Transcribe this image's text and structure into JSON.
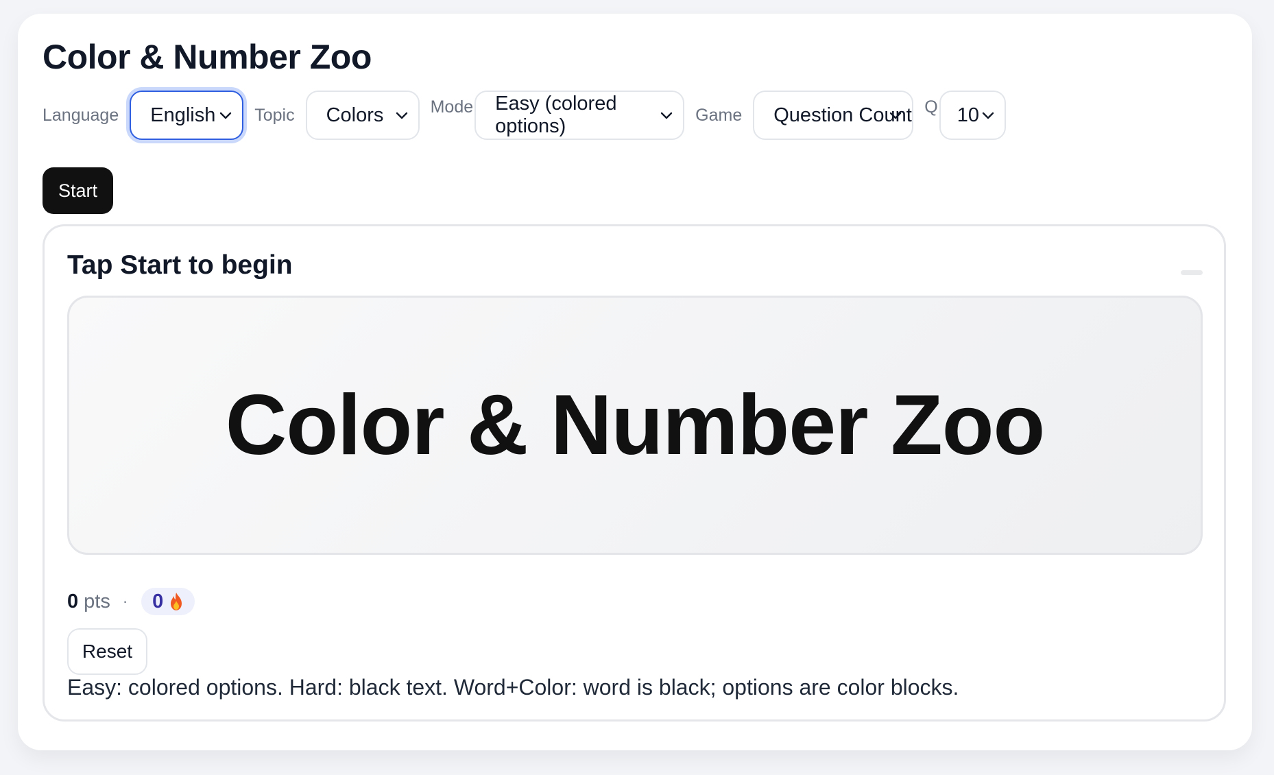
{
  "app": {
    "title": "Color & Number Zoo"
  },
  "controls": {
    "language": {
      "label": "Language",
      "value": "English"
    },
    "topic": {
      "label": "Topic",
      "value": "Colors"
    },
    "mode": {
      "label": "Mode",
      "value": "Easy (colored options)"
    },
    "game": {
      "label": "Game",
      "value": "Question Count"
    },
    "questions": {
      "label": "Q",
      "value": "10"
    }
  },
  "start_label": "Start",
  "panel": {
    "prompt": "Tap Start to begin",
    "stage_word": "Color & Number Zoo",
    "score": {
      "value": "0",
      "unit": "pts",
      "separator": "·"
    },
    "streak": {
      "value": "0",
      "icon": "fire-icon"
    },
    "reset_label": "Reset",
    "help": "Easy: colored options. Hard: black text. Word+Color: word is black; options are color blocks."
  },
  "colors": {
    "accent_focus": "#2f5fe0",
    "primary_button": "#111111",
    "streak_text": "#3730a3",
    "streak_bg": "#eef0fb"
  }
}
